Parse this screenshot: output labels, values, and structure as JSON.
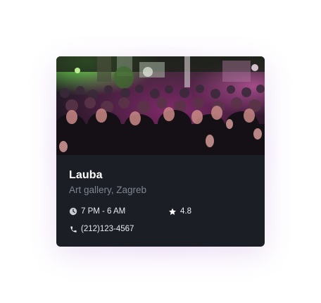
{
  "venue": {
    "name": "Lauba",
    "subtitle": "Art gallery, Zagreb",
    "hours": "7 PM - 6 AM",
    "rating": "4.8",
    "phone": "(212)123-4567"
  },
  "icons": {
    "hours": "clock-icon",
    "rating": "star-icon",
    "phone": "phone-icon"
  },
  "colors": {
    "card_background": "#1b1e24",
    "title": "#ffffff",
    "subtitle": "#7f8590",
    "meta_text": "#e9ebef",
    "icon": "#c9ccd2"
  }
}
